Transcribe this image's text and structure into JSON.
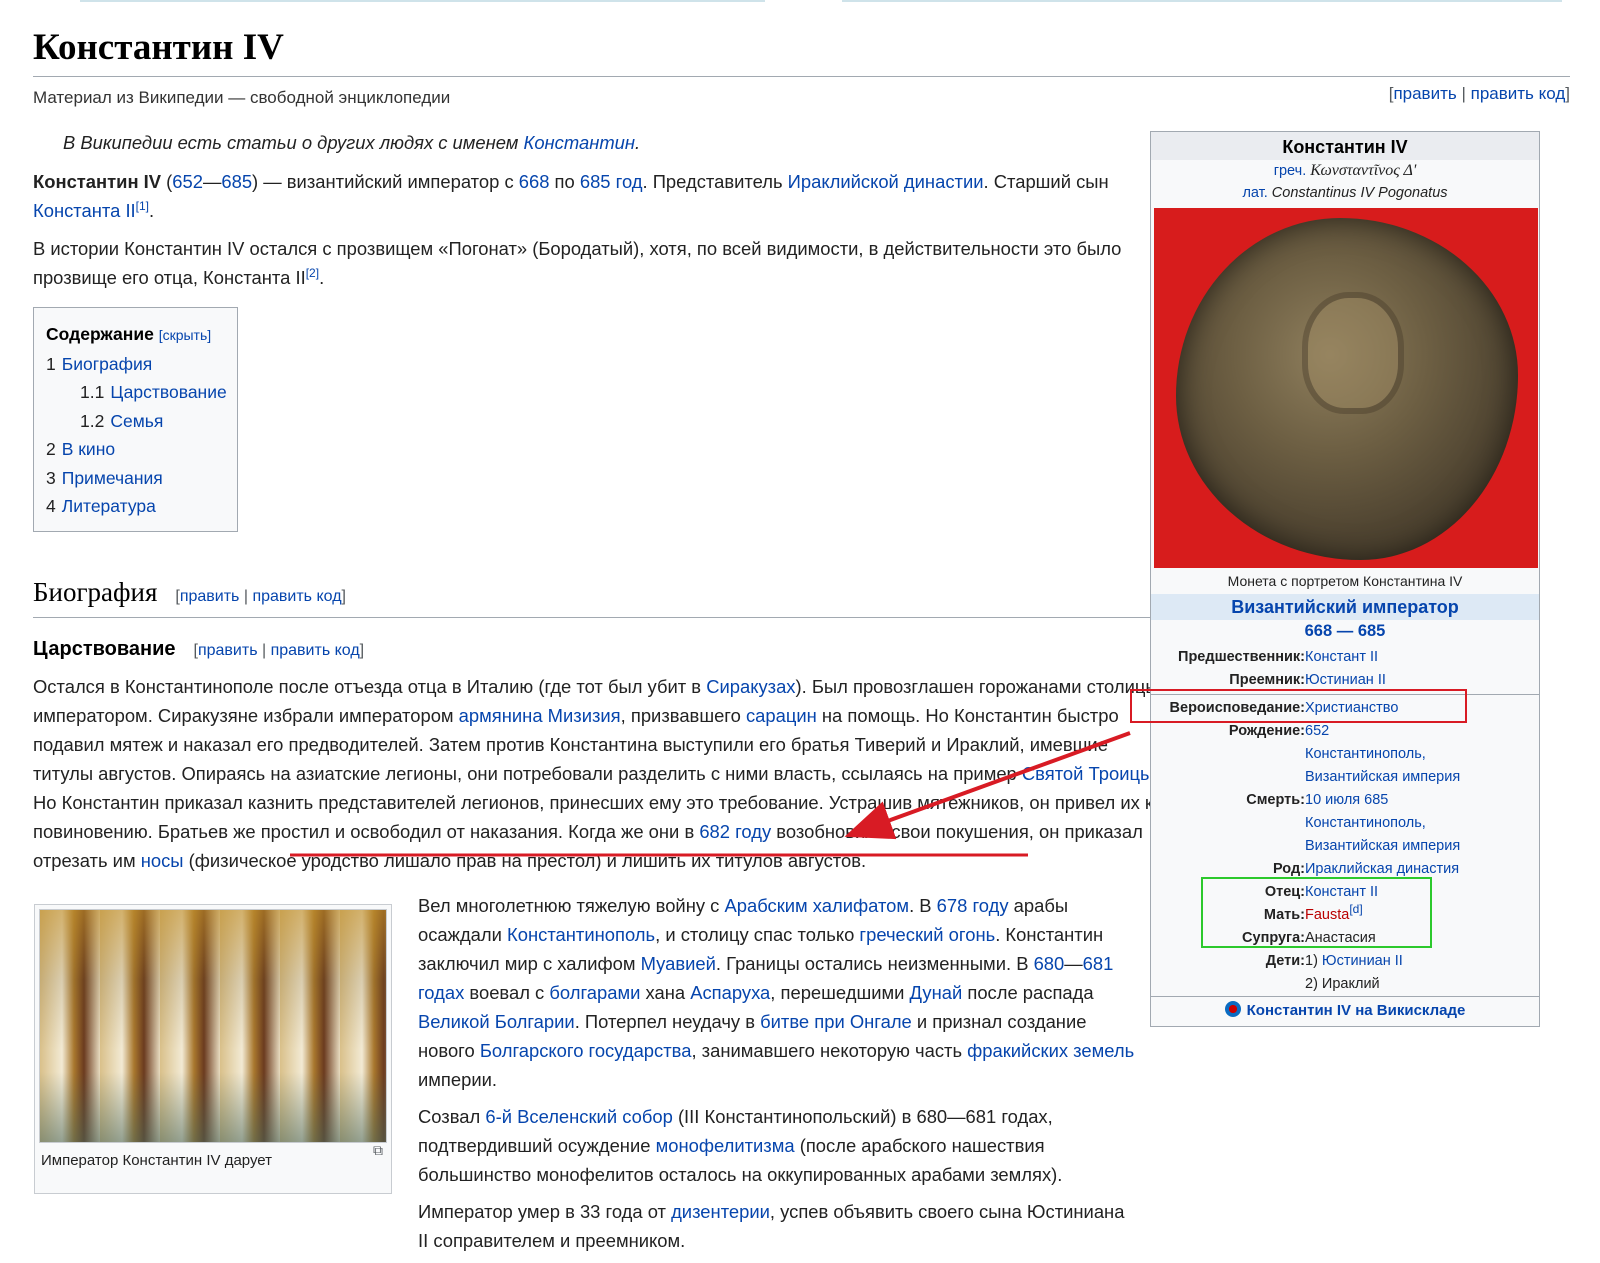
{
  "page": {
    "title": "Константин IV",
    "subtitle": "Материал из Википедии — свободной энциклопедии",
    "edit_open": "[",
    "edit": "править",
    "edit_sep": "|",
    "edit_code": "править код",
    "edit_close": "]"
  },
  "hatnote": {
    "text": "В Википедии есть статьи о других людях с именем ",
    "link": "Константин",
    "end": "."
  },
  "intro": {
    "p1": {
      "name": "Константин IV",
      "open": " (",
      "birth": "652",
      "dash": "—",
      "death": "685",
      "t1": ") — византийский император с ",
      "y1": "668",
      "t2": " по ",
      "y2": "685 год",
      "t3": ". Представитель ",
      "dyn": "Ираклийской династии",
      "t4": ". Старший сын ",
      "father": "Константа II",
      "ref": "[1]",
      "end": "."
    },
    "p2": {
      "text": "В истории Константин IV остался с прозвищем «Погонат» (Бородатый), хотя, по всей видимости, в действительности это было прозвище его отца, Константа II",
      "ref": "[2]",
      "end": "."
    }
  },
  "toc": {
    "title": "Содержание",
    "hide": "[скрыть]",
    "items": [
      {
        "num": "1",
        "label": "Биография"
      },
      {
        "num": "1.1",
        "label": "Царствование"
      },
      {
        "num": "1.2",
        "label": "Семья"
      },
      {
        "num": "2",
        "label": "В кино"
      },
      {
        "num": "3",
        "label": "Примечания"
      },
      {
        "num": "4",
        "label": "Литература"
      }
    ]
  },
  "biography": {
    "heading": "Биография",
    "sub_heading": "Царствование",
    "p1": {
      "a": "Остался в Константинополе после отъезда отца в Италию (где тот был убит в ",
      "l1": "Сиракузах",
      "b": "). Был провозглашен горожанами столицы императором. Сиракузяне избрали императором ",
      "l2": "армянина",
      "c": " ",
      "l3": "Мизизия",
      "d": ", призвавшего ",
      "l4": "сарацин",
      "e": " на помощь. Но Константин быстро подавил мятеж и наказал его предводителей. Затем против Константина выступили его братья Тиверий и Ираклий, имевшие титулы августов. Опираясь на азиатские легионы, они потребовали разделить с ними власть, ссылаясь на пример ",
      "l5": "Святой Троицы",
      "f": ". Но Константин приказал казнить представителей легионов, принесших ему это требование. Устрашив мятежников, он привел их к повиновению. Братьев же простил и освободил от наказания. Когда же они в ",
      "l6": "682 году",
      "g": " возобновили свои покушения, он приказал отрезать им ",
      "l7": "носы",
      "h": " (физическое уродство лишало прав на престол) и лишить их титулов августов."
    },
    "p2": {
      "a": "Вел многолетнюю тяжелую войну с ",
      "l1": "Арабским халифатом",
      "b": ". В ",
      "l2": "678 году",
      "c": " арабы осаждали ",
      "l3": "Константинополь",
      "d": ", и столицу спас только ",
      "l4": "греческий огонь",
      "e": ". Константин заключил мир с халифом ",
      "l5": "Муавией",
      "f": ". Границы остались неизменными. В ",
      "l6": "680",
      "g": "—",
      "l7": "681 годах",
      "h": " воевал с ",
      "l8": "болгарами",
      "i": " хана ",
      "l9": "Аспаруха",
      "j": ", перешедшими ",
      "l10": "Дунай",
      "k": " после распада ",
      "l11": "Великой Болгарии",
      "l": ". Потерпел неудачу в ",
      "l12": "битве при Онгале",
      "m": " и признал создание нового ",
      "l13": "Болгарского государства",
      "n": ", занимавшего некоторую часть ",
      "l14": "фракийских земель",
      "o": " империи."
    },
    "p3": {
      "a": "Созвал ",
      "l1": "6-й Вселенский собор",
      "b": " (III Константинопольский) в 680—681 годах, подтвердивший осуждение ",
      "l2": "монофелитизма",
      "c": " (после арабского нашествия большинство монофелитов осталось на оккупированных арабами землях)."
    },
    "p4": {
      "a": "Император умер в 33 года от ",
      "l1": "дизентерии",
      "b": ", успев объявить своего сына Юстиниана II соправителем и преемником."
    }
  },
  "thumb": {
    "caption": "Император Константин IV дарует",
    "enlarge": "⧉"
  },
  "infobox": {
    "title": "Константин IV",
    "greek_prefix": "греч. ",
    "greek": "Κωνσταντῖνος Δ'",
    "latin_prefix": "лат. ",
    "latin": "Constantinus IV Pogonatus",
    "coin_caption": "Монета с портретом Константина IV",
    "header": "Византийский император",
    "years": "668 — 685",
    "predecessor_label": "Предшественник:",
    "predecessor": "Констант II",
    "successor_label": "Преемник:",
    "successor": "Юстиниан II",
    "religion_label": "Вероисповедание:",
    "religion": "Христианство",
    "birth_label": "Рождение:",
    "birth_year": "652",
    "birth_place1": "Константинополь,",
    "birth_place2": "Византийская империя",
    "death_label": "Смерть:",
    "death_date": "10 июля 685",
    "death_place1": "Константинополь,",
    "death_place2": "Византийская империя",
    "dynasty_label": "Род:",
    "dynasty": "Ираклийская династия",
    "father_label": "Отец:",
    "father": "Констант II",
    "mother_label": "Мать:",
    "mother": "Fausta",
    "mother_ref": "[d]",
    "spouse_label": "Супруга:",
    "spouse": "Анастасия",
    "children_label": "Дети:",
    "child1_prefix": "1) ",
    "child1": "Юстиниан II",
    "child2": "2) Ираклий",
    "commons": "Константин IV на Викискладе"
  },
  "colors": {
    "link": "#0645ad",
    "redlink": "#ba0000",
    "annotation_red": "#d81b24",
    "annotation_green": "#2cc92c",
    "coin_background": "#d71c1c"
  }
}
